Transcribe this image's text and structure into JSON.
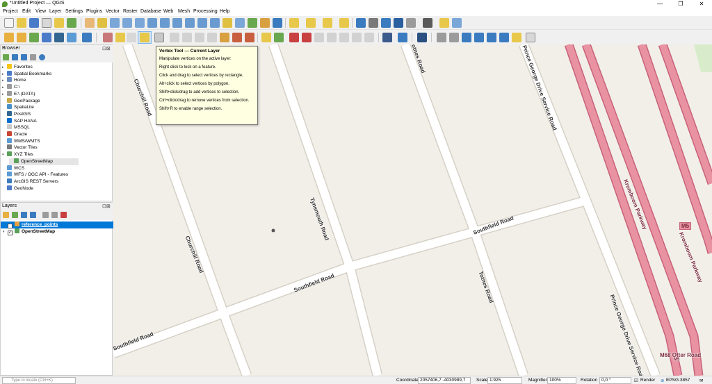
{
  "window": {
    "title": "*Untitled Project — QGIS",
    "minimize": "—",
    "maximize": "❐",
    "close": "✕"
  },
  "menu": [
    "Project",
    "Edit",
    "View",
    "Layer",
    "Settings",
    "Plugins",
    "Vector",
    "Raster",
    "Database",
    "Web",
    "Mesh",
    "Processing",
    "Help"
  ],
  "browser": {
    "title": "Browser",
    "controls": "⊡⊠",
    "items": [
      {
        "label": "Favorites",
        "icon_color": "#f5c518",
        "expander": "▸"
      },
      {
        "label": "Spatial Bookmarks",
        "icon_color": "#4a7bc8",
        "expander": "▸"
      },
      {
        "label": "Home",
        "icon_color": "#6c8ebf",
        "expander": "▸"
      },
      {
        "label": "C:\\",
        "icon_color": "#9b9b9b",
        "expander": "▸"
      },
      {
        "label": "E:\\ (DATA)",
        "icon_color": "#9b9b9b",
        "expander": "▸"
      },
      {
        "label": "GeoPackage",
        "icon_color": "#c8a84a",
        "expander": ""
      },
      {
        "label": "SpatiaLite",
        "icon_color": "#4a90c8",
        "expander": ""
      },
      {
        "label": "PostGIS",
        "icon_color": "#336791",
        "expander": ""
      },
      {
        "label": "SAP HANA",
        "icon_color": "#0a6ed1",
        "expander": ""
      },
      {
        "label": "MSSQL",
        "icon_color": "#c8c8c8",
        "expander": ""
      },
      {
        "label": "Oracle",
        "icon_color": "#c74634",
        "expander": ""
      },
      {
        "label": "WMS/WMTS",
        "icon_color": "#5a9bd5",
        "expander": ""
      },
      {
        "label": "Vector Tiles",
        "icon_color": "#7a7a7a",
        "expander": ""
      },
      {
        "label": "XYZ Tiles",
        "icon_color": "#5aa05a",
        "expander": "▾"
      },
      {
        "label": "OpenStreetMap",
        "icon_color": "#5aa05a",
        "expander": "",
        "child": true,
        "selected": true
      },
      {
        "label": "WCS",
        "icon_color": "#5a9bd5",
        "expander": ""
      },
      {
        "label": "WFS / OGC API - Features",
        "icon_color": "#5a9bd5",
        "expander": ""
      },
      {
        "label": "ArcGIS REST Servers",
        "icon_color": "#3b7bbf",
        "expander": ""
      },
      {
        "label": "GeoNode",
        "icon_color": "#4a7bc8",
        "expander": ""
      }
    ]
  },
  "layers": {
    "title": "Layers",
    "controls": "⊡⊠",
    "items": [
      {
        "label": "reference_points",
        "selected": true,
        "checked": "✓",
        "expander": ""
      },
      {
        "label": "OpenStreetMap",
        "selected": false,
        "checked": "✓",
        "expander": "▾"
      }
    ]
  },
  "tooltip": {
    "title": "Vertex Tool — Current Layer",
    "lines": [
      "Manipulate vertices on the active layer:",
      "Right click to lock on a feature.",
      "Click and drag to select vertices by rectangle.",
      "Alt+click to select vertices by polygon.",
      "Shift+click/drag to add vertices to selection.",
      "Ctrl+click/drag to remove vertices from selection.",
      "Shift+R to enable range selection."
    ]
  },
  "map": {
    "roads": {
      "churchill_1": "Churchill Road",
      "churchill_2": "Churchill Road",
      "tynemouth": "Tynemouth Road",
      "totnes_1": "Totnes Road",
      "totnes_2": "Totnes Road",
      "southfield_1": "Southfield Road",
      "southfield_2": "Southfield Road",
      "southfield_3": "Southfield Road",
      "prince_george_1": "Prince George Drive Service Road",
      "prince_george_2": "Prince George Drive Service Road",
      "kromboom_1": "Kromboom Parkway",
      "kromboom_2": "Kromboom Parkway",
      "m5_shield": "M5",
      "m68": "M68 Otter Road",
      "m68_ref": "M5"
    },
    "colors": {
      "land": "#f2efe9",
      "road": "#ffffff",
      "road_casing": "#d6d0c6",
      "motorway": "#e892a2",
      "motorway_casing": "#c8627a",
      "park": "#d8eccb"
    }
  },
  "status": {
    "locator_placeholder": "Type to locate (Ctrl+K)",
    "coordinate_label": "Coordinate",
    "coordinate_value": "2057406,7 -4030989,7",
    "scale_label": "Scale",
    "scale_value": "1:925",
    "magnifier_label": "Magnifier",
    "magnifier_value": "100%",
    "rotation_label": "Rotation",
    "rotation_value": "0,0 °",
    "render_label": "Render",
    "crs_value": "EPSG:3857"
  }
}
